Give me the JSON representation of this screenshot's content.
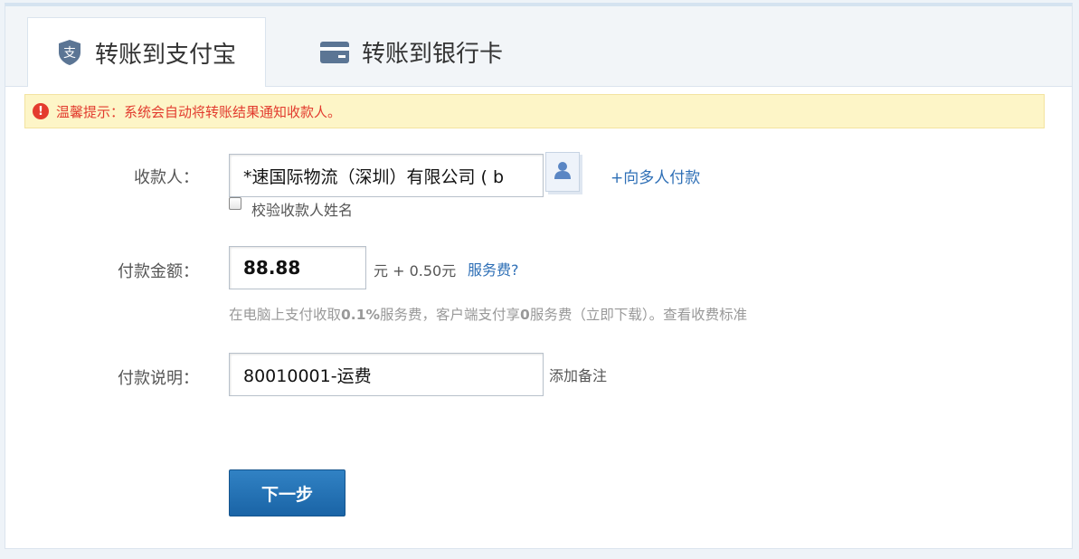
{
  "tabs": [
    {
      "label": "转账到支付宝",
      "icon": "alipay-shield-icon",
      "active": true
    },
    {
      "label": "转账到银行卡",
      "icon": "bank-card-icon",
      "active": false
    }
  ],
  "notice": {
    "icon": "warning-icon",
    "text": "温馨提示：系统会自动将转账结果通知收款人。"
  },
  "payee": {
    "label": "收款人：",
    "value": "*速国际物流（深圳）有限公司 ( b",
    "contacts_icon": "person-icon",
    "multi_payee_link": "+向多人付款",
    "verify_checkbox_label": "校验收款人姓名",
    "verify_checked": false
  },
  "amount": {
    "label": "付款金额：",
    "value": "88.88",
    "fee_text": "元 + 0.50元",
    "fee_link": "服务费?",
    "hint_part1": "在电脑上支付收取",
    "hint_rate": "0.1%",
    "hint_part2": "服务费，客户端支付享",
    "hint_zero": "0",
    "hint_part3": "服务费（立即下载）。查看收费标准"
  },
  "memo": {
    "label": "付款说明：",
    "value": "80010001-运费",
    "add_note": "添加备注"
  },
  "next_button": "下一步",
  "colors": {
    "accent": "#2e6fb6",
    "notice_bg": "#fdf5c7",
    "notice_text": "#e23b2e",
    "button": "#1f6aab"
  }
}
